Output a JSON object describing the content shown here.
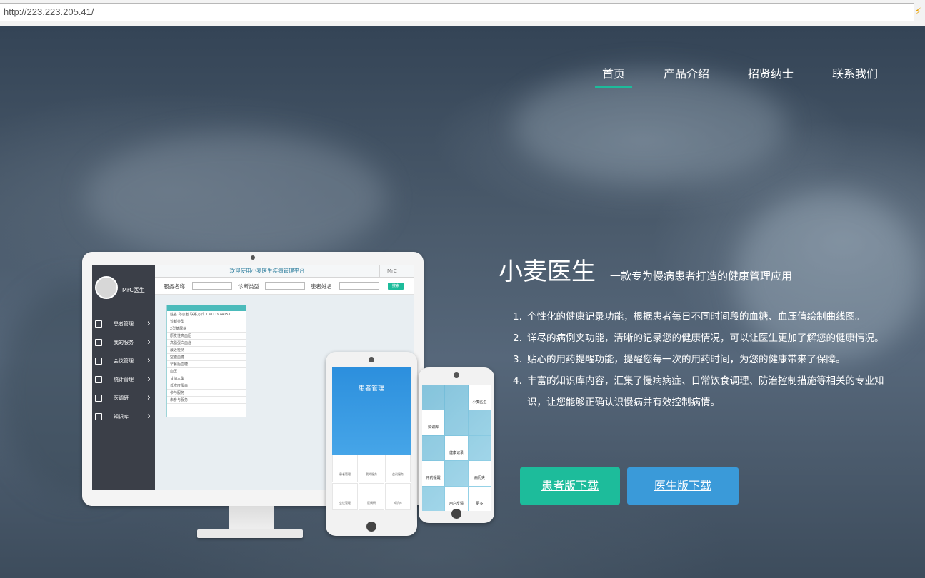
{
  "browser": {
    "url": "http://223.223.205.41/"
  },
  "nav": {
    "items": [
      {
        "label": "首页",
        "active": true
      },
      {
        "label": "产品介绍",
        "active": false
      },
      {
        "label": "招贤纳士",
        "active": false
      },
      {
        "label": "联系我们",
        "active": false
      }
    ]
  },
  "hero": {
    "brand": "小麦医生",
    "tagline": "一款专为慢病患者打造的健康管理应用",
    "features": [
      "个性化的健康记录功能，根据患者每日不同时间段的血糖、血压值绘制曲线图。",
      "详尽的病例夹功能，清晰的记录您的健康情况，可以让医生更加了解您的健康情况。",
      "贴心的用药提醒功能，提醒您每一次的用药时间，为您的健康带来了保障。",
      "丰富的知识库内容，汇集了慢病病症、日常饮食调理、防治控制措施等相关的专业知识，让您能够正确认识慢病并有效控制病情。"
    ],
    "buttons": {
      "patient": "患者版下载",
      "doctor": "医生版下载"
    }
  },
  "monitor": {
    "title": "欢迎使用小麦医生疾病管理平台",
    "user_corner": "MrC",
    "user": "MrC医生",
    "menu": [
      "患者管理",
      "我的服务",
      "会议管理",
      "统计管理",
      "医调研",
      "知识库"
    ],
    "filters": {
      "service": "服务名称",
      "type": "诊断类型",
      "patient": "患者姓名",
      "search": "搜索"
    },
    "card_rows": [
      "姓名  孙患者  联系方式 13811974057",
      "诊断类型",
      "2型糖尿病",
      "原发性高血压",
      "高脂蛋白血症",
      "最近检测",
      "空腹血糖",
      "早餐后血糖",
      "血压",
      "甘油三酯",
      "低密度蛋白",
      "参与服务",
      "未参与服务"
    ]
  },
  "phone1": {
    "title": "患者管理",
    "grid": [
      "患者管理",
      "我的服务",
      "会议服务",
      "会议管理",
      "医调研",
      "知识库"
    ]
  },
  "phone2": {
    "tiles": [
      "小麦医生",
      "知识库",
      "健康记录",
      "用药提醒",
      "病历夹",
      "用户反馈",
      "更多"
    ]
  }
}
